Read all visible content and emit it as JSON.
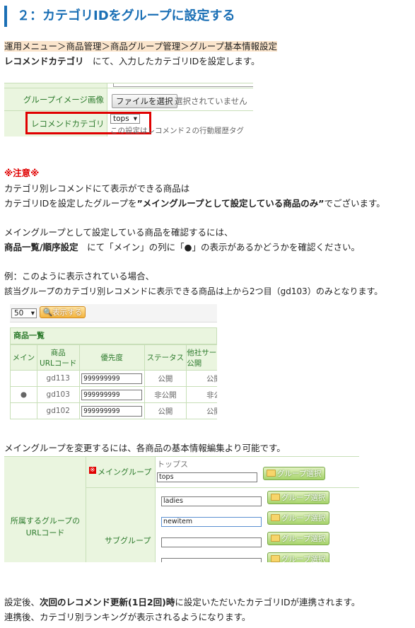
{
  "heading": "２：カテゴリIDをグループに設定する",
  "menu_path": "運用メニュー＞商品管理＞商品グループ管理＞グループ基本情報設定",
  "setting_line": {
    "bold": "レコメンドカテゴリ",
    "rest": "　にて、入力したカテゴリIDを設定します。"
  },
  "shot1": {
    "row1_label": "グループイメージ画像",
    "file_button": "ファイルを選択",
    "file_status": "選択されていません",
    "row2_label": "レコメンドカテゴリ",
    "select_value": "tops",
    "note": "この設定はレコメンド２の行動履歴タグ"
  },
  "notice_title": "※注意※",
  "notice_line1": "カテゴリ別レコメンドにて表示ができる商品は",
  "notice_line2": {
    "pre": "カテゴリIDを設定したグループを",
    "bold": "”メイングループとして設定している商品のみ”",
    "post": "でございます。"
  },
  "check_line1": "メイングループとして設定している商品を確認するには、",
  "check_line2": {
    "bold": "商品一覧/順序設定",
    "rest": "　にて「メイン」の列に「●」の表示があるかどうかを確認ください。"
  },
  "example_line1": "例：このように表示されている場合、",
  "example_line2": "該当グループのカテゴリ別レコメンドに表示できる商品は上から2つ目（gd103）のみとなります。",
  "shot2": {
    "per_page": "50",
    "show_button": "表示する",
    "list_title": "商品一覧",
    "headers": [
      "メイン",
      "商品\nURLコード",
      "優先度",
      "ステータス",
      "他社サー\n公開"
    ],
    "rows": [
      {
        "main": "",
        "code": "gd113",
        "priority": "999999999",
        "status": "公開",
        "other": "公開"
      },
      {
        "main": "●",
        "code": "gd103",
        "priority": "999999999",
        "status": "非公開",
        "other": "非公"
      },
      {
        "main": "",
        "code": "gd102",
        "priority": "999999999",
        "status": "公開",
        "other": "公開"
      }
    ]
  },
  "change_line": "メイングループを変更するには、各商品の基本情報編集より可能です。",
  "shot3": {
    "left_label": "所属するグループの\nURLコード",
    "main_mark": "※",
    "main_label": "メイングループ",
    "main_name": "トップス",
    "main_value": "tops",
    "sub_label": "サブグループ",
    "sub_values": [
      "ladies",
      "newitem",
      "",
      ""
    ],
    "group_button": "グループ選択"
  },
  "after_line1": {
    "pre": "設定後、",
    "bold": "次回のレコメンド更新(1日2回)時",
    "post": "に設定いただいたカテゴリIDが連携されます。"
  },
  "after_line2": "連携後、カテゴリ別ランキングが表示されるようになります。",
  "colors": {
    "heading": "#1a6fb5",
    "highlight": "#fbe5cc",
    "notice": "#e00000",
    "table_header": "#eaf5df"
  }
}
